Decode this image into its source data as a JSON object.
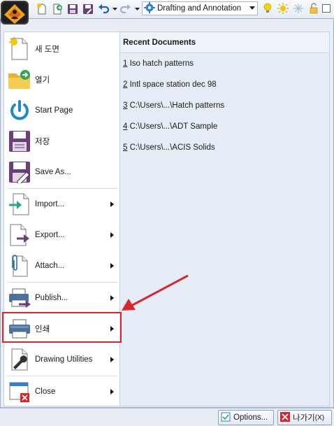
{
  "toolbar": {
    "workspace": "Drafting and Annotation",
    "layer_count": "0",
    "icons": [
      "app-menu-icon",
      "new-icon",
      "open-icon",
      "save-icon",
      "save-as-icon",
      "undo-icon",
      "redo-icon",
      "gear-icon",
      "lightbulb-icon",
      "sun-icon",
      "snowflake-icon",
      "lock-icon",
      "checkbox"
    ]
  },
  "menu": {
    "items": [
      {
        "label": "새 도면",
        "icon": "new-drawing-icon"
      },
      {
        "label": "열기",
        "icon": "open-folder-icon"
      },
      {
        "label": "Start Page",
        "icon": "power-icon"
      },
      {
        "label": "저장",
        "icon": "save-icon"
      },
      {
        "label": "Save As...",
        "icon": "save-as-icon"
      },
      {
        "label": "Import...",
        "icon": "import-icon"
      },
      {
        "label": "Export...",
        "icon": "export-icon"
      },
      {
        "label": "Attach...",
        "icon": "paperclip-icon"
      },
      {
        "label": "Publish...",
        "icon": "publish-printer-icon"
      },
      {
        "label": "인쇄",
        "icon": "printer-icon"
      },
      {
        "label": "Drawing Utilities",
        "icon": "wrench-icon"
      },
      {
        "label": "Close",
        "icon": "close-drawing-icon"
      }
    ]
  },
  "recent": {
    "header": "Recent Documents",
    "items": [
      {
        "num": "1",
        "name": " Iso hatch patterns"
      },
      {
        "num": "2",
        "name": " Intl space station dec 98"
      },
      {
        "num": "3",
        "name": " C:\\Users\\...\\Hatch patterns"
      },
      {
        "num": "4",
        "name": " C:\\Users\\...\\ADT Sample"
      },
      {
        "num": "5",
        "name": " C:\\Users\\...\\ACIS Solids"
      }
    ]
  },
  "bottom": {
    "options_label": "Options...",
    "exit_label": "나가기",
    "exit_shortcut": "(X)"
  },
  "colors": {
    "highlight": "#d9262c",
    "accent": "#2c7fd1"
  }
}
